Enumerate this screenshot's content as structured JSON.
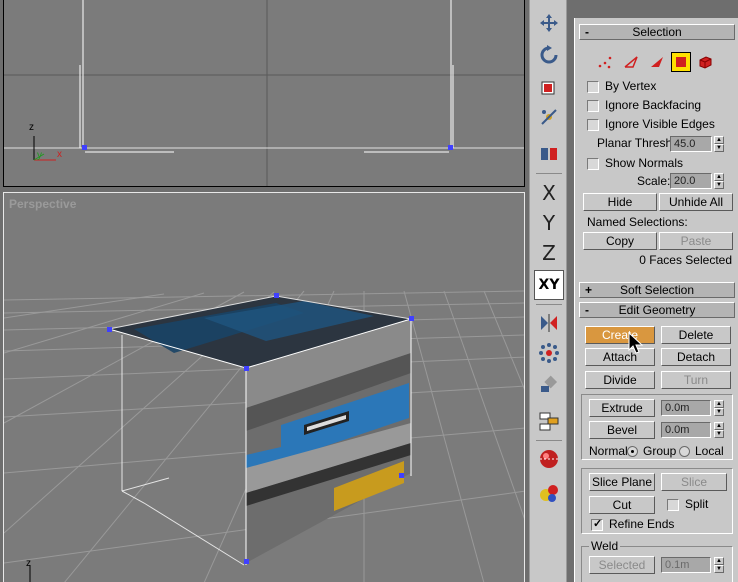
{
  "viewports": {
    "top": {
      "label": "",
      "axis_z": "z",
      "axis_y": "y",
      "axis_x": "x"
    },
    "perspective": {
      "label": "Perspective",
      "axis_z": "z"
    }
  },
  "toolbar": {
    "items": [
      "move-icon",
      "rotate-icon",
      "scale-icon",
      "pivot-icon",
      "mirror-select-icon",
      "X",
      "Y",
      "Z",
      "XY",
      "mirror-icon",
      "array-icon",
      "align-icon",
      "layers-icon",
      "material-editor-icon",
      "render-icon"
    ]
  },
  "selection": {
    "header": "Selection",
    "header_sign": "-",
    "by_vertex": "By Vertex",
    "ignore_backfacing": "Ignore Backfacing",
    "ignore_visible_edges": "Ignore Visible Edges",
    "planar_thresh_label": "Planar Thresh:",
    "planar_thresh_value": "45.0",
    "show_normals": "Show Normals",
    "scale_label": "Scale:",
    "scale_value": "20.0",
    "hide": "Hide",
    "unhide_all": "Unhide All",
    "named_selections": "Named Selections:",
    "copy": "Copy",
    "paste": "Paste",
    "status": "0 Faces Selected"
  },
  "soft_selection": {
    "header": "Soft Selection",
    "header_sign": "+"
  },
  "edit_geometry": {
    "header": "Edit Geometry",
    "header_sign": "-",
    "create": "Create",
    "delete": "Delete",
    "attach": "Attach",
    "detach": "Detach",
    "divide": "Divide",
    "turn": "Turn",
    "extrude": "Extrude",
    "extrude_value": "0.0m",
    "bevel": "Bevel",
    "bevel_value": "0.0m",
    "normal_label": "Normal:",
    "group": "Group",
    "local": "Local",
    "slice_plane": "Slice Plane",
    "slice": "Slice",
    "cut": "Cut",
    "split": "Split",
    "refine_ends": "Refine Ends",
    "weld_label": "Weld",
    "selected": "Selected",
    "weld_value": "0.1m"
  },
  "colors": {
    "accent_active": "#d9973f",
    "vertex": "#4040ff",
    "highlight_yellow": "#ffe000"
  }
}
